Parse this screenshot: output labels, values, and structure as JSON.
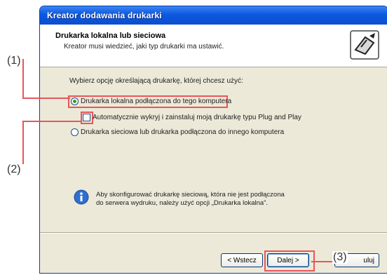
{
  "window": {
    "title": "Kreator dodawania drukarki"
  },
  "header": {
    "title": "Drukarka lokalna lub sieciowa",
    "subtitle": "Kreator musi wiedzieć, jaki typ drukarki ma ustawić."
  },
  "body": {
    "prompt": "Wybierz opcję określającą drukarkę, której chcesz użyć:",
    "option_local": "Drukarka lokalna podłączona do tego komputera",
    "option_pnp": "Automatycznie wykryj i zainstaluj moją drukarkę typu Plug and Play",
    "option_network": "Drukarka sieciowa lub drukarka podłączona do innego komputera",
    "info_line1": "Aby skonfigurować drukarkę sieciową, która nie jest podłączona",
    "info_line2": "do serwera wydruku, należy użyć opcji „Drukarka lokalna”."
  },
  "buttons": {
    "back": "< Wstecz",
    "next": "Dalej >",
    "cancel": "Anuluj",
    "cancel_visible": "uluj"
  },
  "callouts": {
    "c1": "(1)",
    "c2": "(2)",
    "c3": "(3)"
  },
  "state": {
    "selected_option": "local",
    "pnp_checked": false
  },
  "colors": {
    "accent": "#e8565a",
    "titlebar": "#0c58e0",
    "window_bg": "#ece9d8"
  },
  "icons": {
    "header": "printer-wizard-icon",
    "info": "info-icon"
  }
}
